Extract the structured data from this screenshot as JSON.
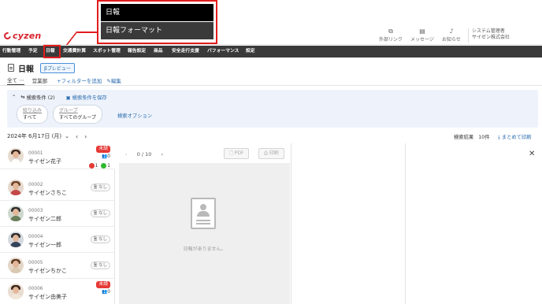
{
  "callout": {
    "item1": "日報",
    "item2": "日報フォーマット"
  },
  "header": {
    "logo_text": "cyzen",
    "tools": [
      {
        "label": "外部リンク",
        "icon": "external-link-icon"
      },
      {
        "label": "メッセージ",
        "icon": "message-icon"
      },
      {
        "label": "お知らせ",
        "icon": "bell-icon"
      }
    ],
    "user_role": "システム管理者",
    "user_company": "サイゼン株式会社"
  },
  "nav": {
    "items": [
      "行動管理",
      "予定",
      "日報",
      "交通費計算",
      "スポット管理",
      "報告設定",
      "商品",
      "安全走行支援",
      "パフォーマンス",
      "設定"
    ]
  },
  "page": {
    "title": "日報",
    "beta": "βプレビュー"
  },
  "tabs": {
    "all": "全て",
    "all_menu": "⋯",
    "sales": "営業部",
    "add_filter": "フィルターを追加",
    "edit": "編集"
  },
  "conditions": {
    "title": "検索条件 (2)",
    "save": "検索条件を保存",
    "filter_label": "絞り込み",
    "filter_value": "すべて",
    "group_label": "グループ",
    "group_value": "すべてのグループ",
    "options": "検索オプション"
  },
  "date_bar": {
    "date": "2024年 6月17日 (月)",
    "result_label": "検索結果",
    "result_count": "10件",
    "print_all": "まとめて印刷"
  },
  "employees": [
    {
      "id": "00001",
      "name": "サイゼン花子",
      "status": "未読",
      "readers": "0",
      "likes": "1",
      "comments": "1"
    },
    {
      "id": "00002",
      "name": "サイゼンさちこ",
      "status": "なし"
    },
    {
      "id": "00003",
      "name": "サイゼン二郎",
      "status": "なし"
    },
    {
      "id": "00004",
      "name": "サイゼン一郎",
      "status": "なし"
    },
    {
      "id": "00005",
      "name": "サイゼンちかこ",
      "status": "なし"
    },
    {
      "id": "00006",
      "name": "サイゼン由美子",
      "status": "未読",
      "readers": "0"
    }
  ],
  "viewer": {
    "pages": "0 / 10",
    "pdf": "PDF",
    "print": "印刷",
    "empty": "日報がありません。"
  },
  "colors": {
    "brand": "#d9232d",
    "nav_bg": "#3a3a3a",
    "link": "#2b6cb0",
    "unread": "#e53935",
    "callout": "#e21d1d"
  }
}
